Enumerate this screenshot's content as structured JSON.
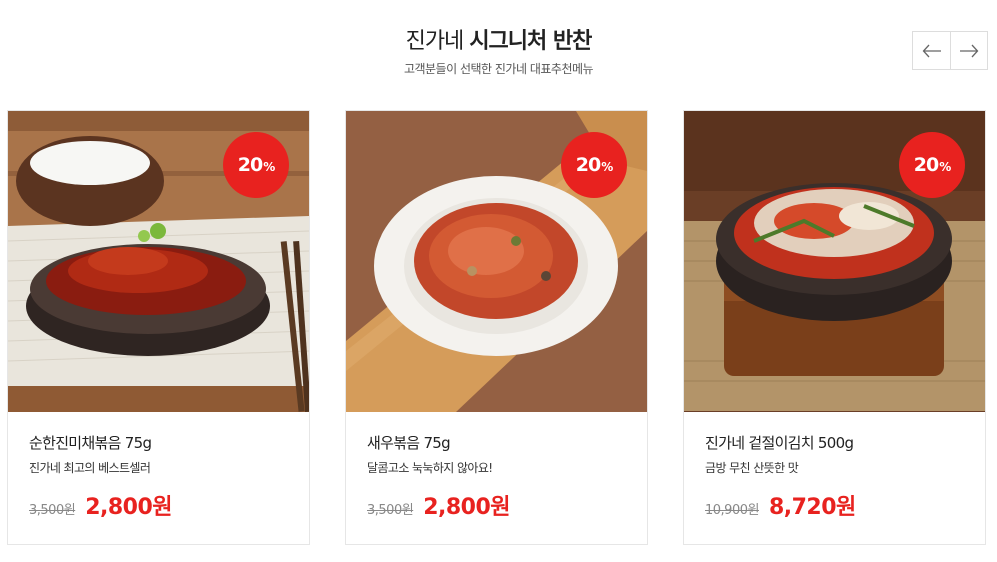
{
  "section": {
    "title_light": "진가네",
    "title_bold": "시그니처 반찬",
    "subtitle": "고객분들이 선택한 진가네 대표추천메뉴"
  },
  "nav": {
    "prev": "←",
    "next": "→"
  },
  "products": [
    {
      "name": "순한진미채볶음 75g",
      "desc": "진가네 최고의 베스트셀러",
      "discount": "20",
      "discount_unit": "%",
      "old_price": "3,500원",
      "new_price": "2,800원"
    },
    {
      "name": "새우볶음 75g",
      "desc": "달콤고소 눅눅하지 않아요!",
      "discount": "20",
      "discount_unit": "%",
      "old_price": "3,500원",
      "new_price": "2,800원"
    },
    {
      "name": "진가네 겉절이김치 500g",
      "desc": "금방 무친 산뜻한 맛",
      "discount": "20",
      "discount_unit": "%",
      "old_price": "10,900원",
      "new_price": "8,720원"
    }
  ],
  "colors": {
    "accent": "#e8221f",
    "text": "#222222",
    "muted": "#888888"
  }
}
